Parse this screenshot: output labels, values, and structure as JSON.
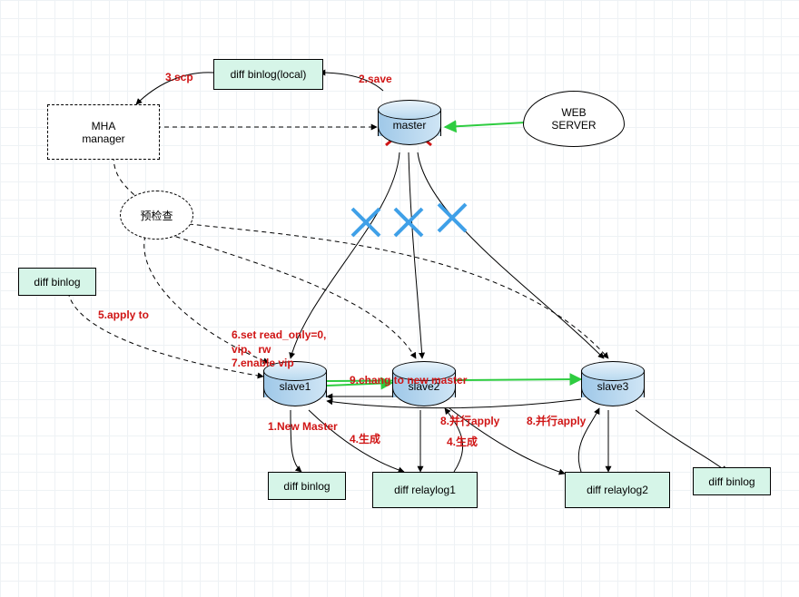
{
  "nodes": {
    "diffBinlogLocal": "diff binlog(local)",
    "mhaManager": "MHA\nmanager",
    "master": "master",
    "webServer": "WEB\nSERVER",
    "precheck": "预检查",
    "diffBinlogLeft": "diff binlog",
    "slave1": "slave1",
    "slave2": "slave2",
    "slave3": "slave3",
    "newMaster": "1.New Master",
    "diffBinlogBL": "diff binlog",
    "diffRelaylog1": "diff relaylog1",
    "diffRelaylog2": "diff relaylog2",
    "diffBinlogBR": "diff binlog"
  },
  "annotations": {
    "save": "2.save",
    "scp": "3.scp",
    "applyTo": "5.apply to",
    "setRO": "6.set read_only=0,\nvip、rw\n7.enable vip",
    "changeNew": "9.chang to new master",
    "parApply1": "8.并行apply",
    "parApply2": "8.并行apply",
    "gen1": "4.生成",
    "gen2": "4.生成"
  }
}
